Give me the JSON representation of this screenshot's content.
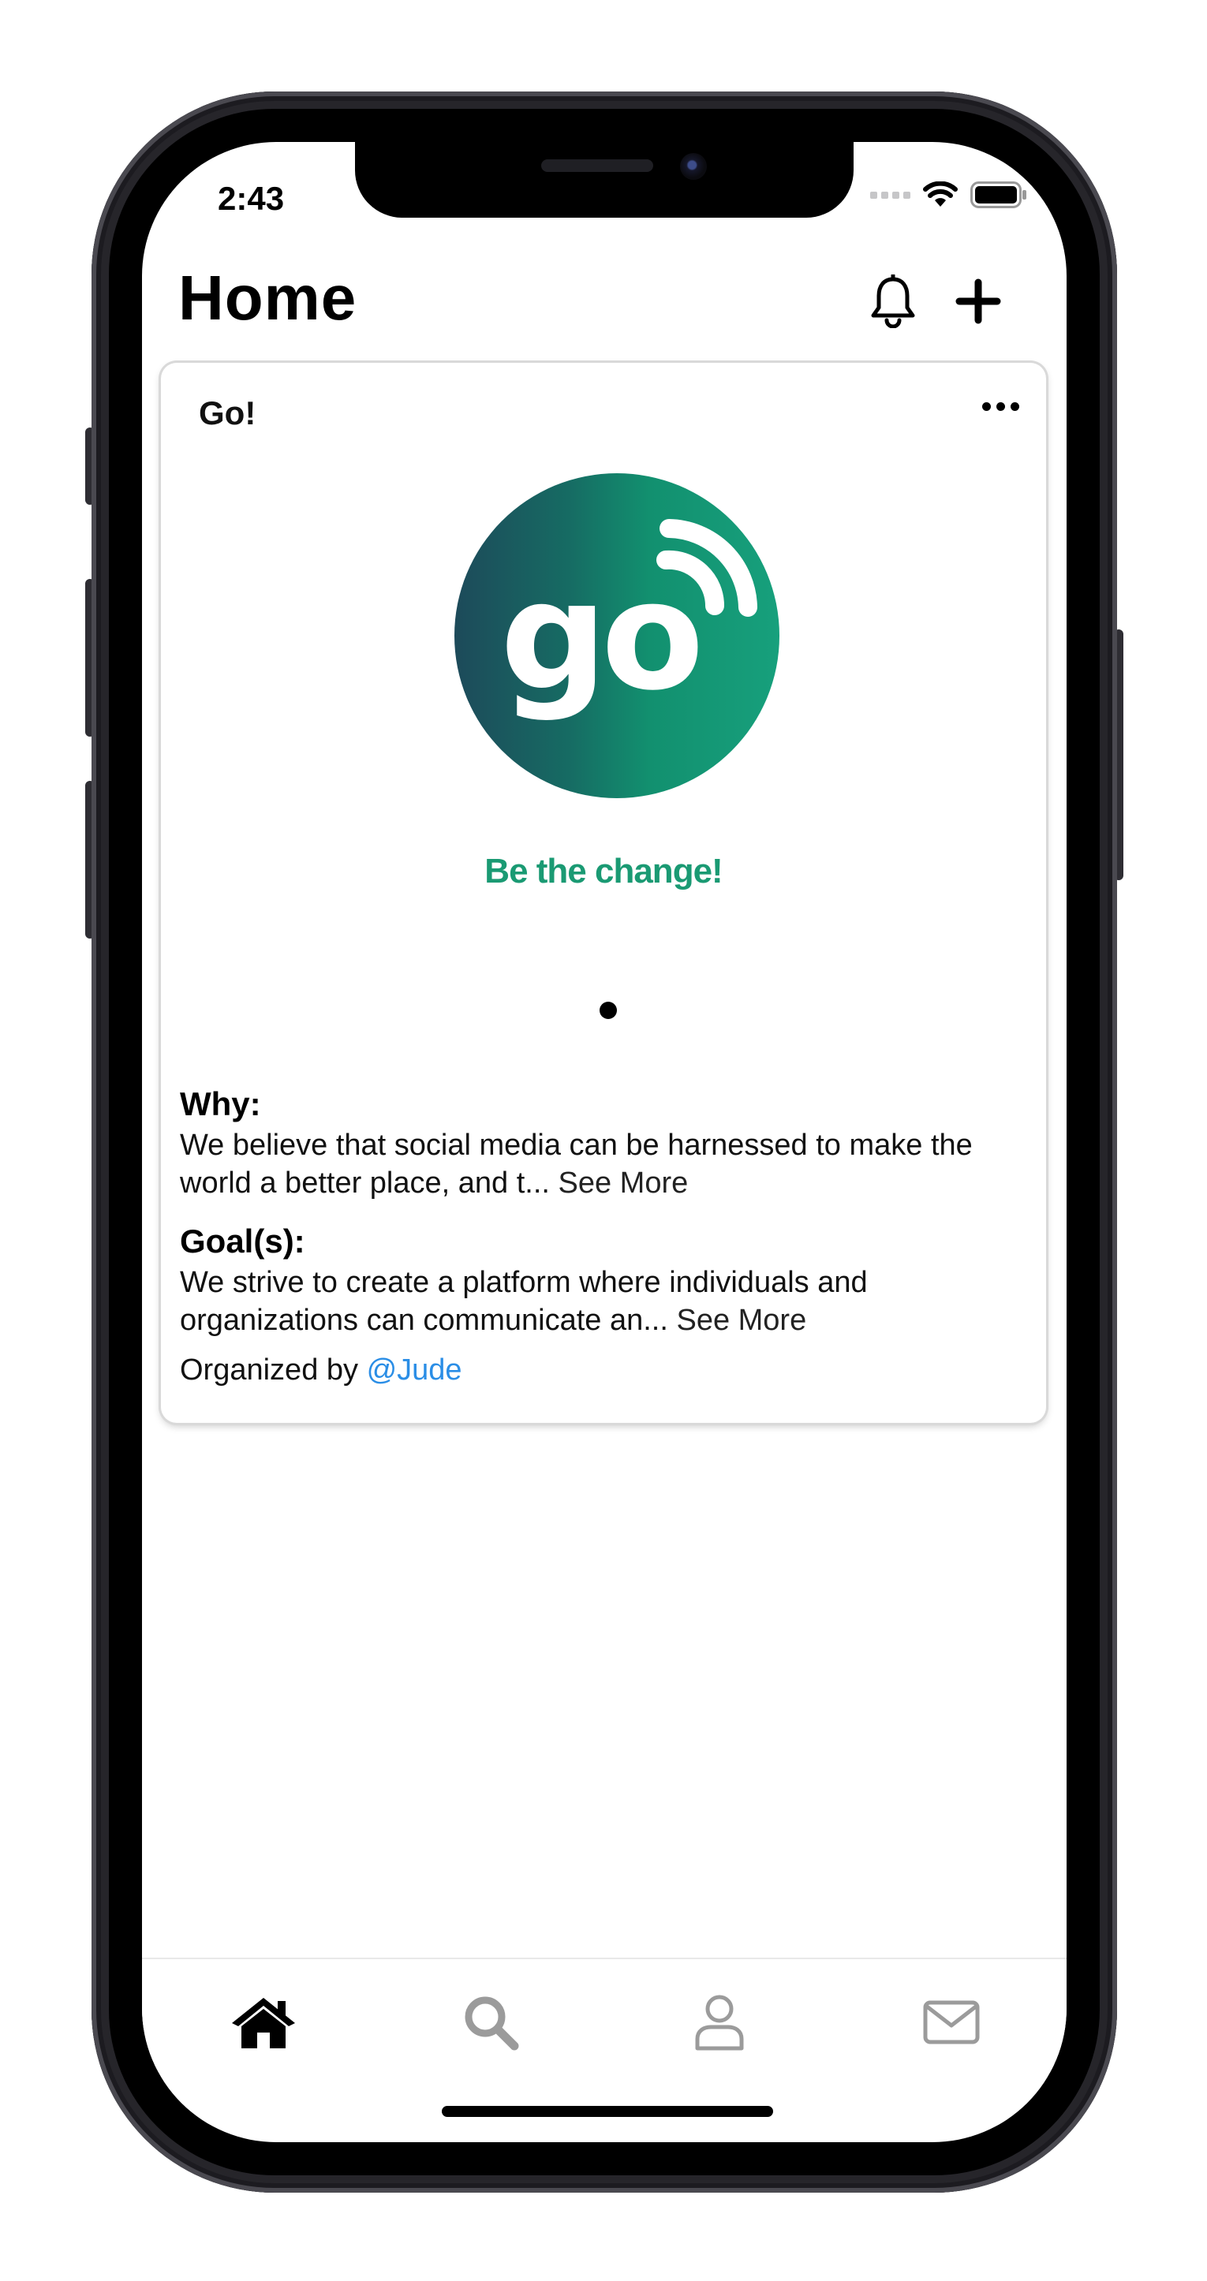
{
  "status_bar": {
    "time": "2:43"
  },
  "header": {
    "title": "Home",
    "notification_icon": "bell-icon",
    "add_icon": "plus-icon"
  },
  "card": {
    "title": "Go!",
    "menu_icon": "ellipsis-icon",
    "logo": {
      "text": "go",
      "tagline": "Be the change!"
    },
    "carousel": {
      "page_count": 1,
      "current_page": 1
    },
    "why": {
      "label": "Why:",
      "text": "We believe that social media can be harnessed to make the world a better place, and t...",
      "see_more": "See More"
    },
    "goals": {
      "label": "Goal(s):",
      "text": "We strive to create a platform where individuals and organizations can communicate an...",
      "see_more": "See More"
    },
    "organizer": {
      "prefix": "Organized by",
      "handle": "@Jude"
    }
  },
  "tab_bar": {
    "items": [
      {
        "icon": "home-icon",
        "active": true
      },
      {
        "icon": "search-icon",
        "active": false
      },
      {
        "icon": "profile-icon",
        "active": false
      },
      {
        "icon": "mail-icon",
        "active": false
      }
    ]
  },
  "colors": {
    "brand_green": "#1a9a73",
    "link_blue": "#2b8ee6",
    "inactive_icon": "#9b9b9b",
    "active_icon": "#000000"
  }
}
